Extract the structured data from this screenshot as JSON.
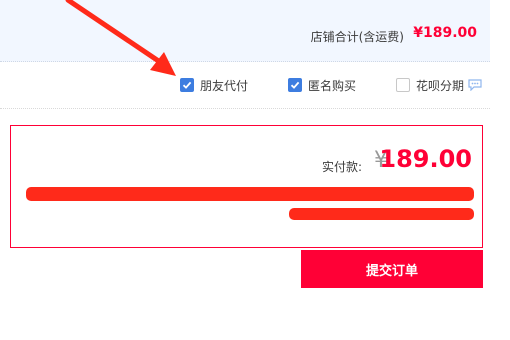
{
  "shop_total": {
    "label": "店铺合计(含运费)",
    "value": "¥189.00"
  },
  "options": [
    {
      "label": "朋友代付",
      "checked": true
    },
    {
      "label": "匿名购买",
      "checked": true
    },
    {
      "label": "花呗分期",
      "checked": false
    }
  ],
  "payment": {
    "label": "实付款:",
    "currency": "¥",
    "amount": "189.00"
  },
  "submit": {
    "label": "提交订单"
  },
  "colors": {
    "accent": "#ff0036",
    "checkbox": "#3d7de0",
    "annotation": "#ff2a1a"
  }
}
